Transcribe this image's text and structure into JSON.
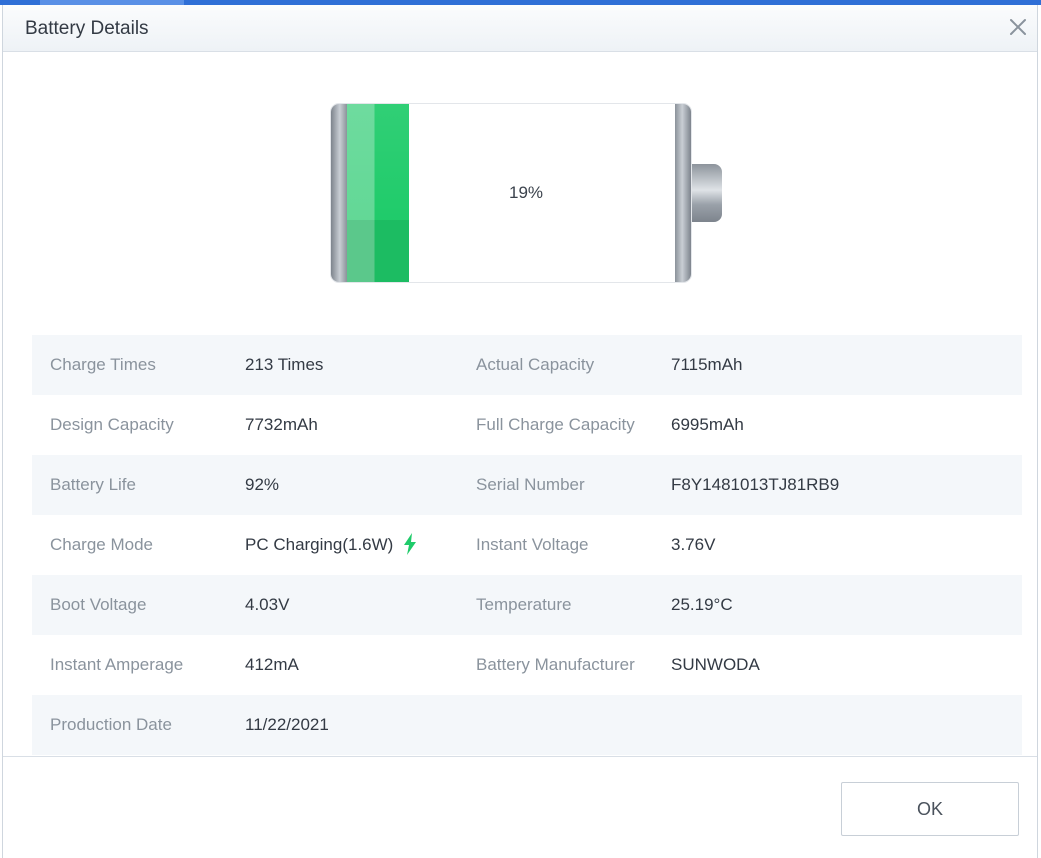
{
  "dialog": {
    "title": "Battery Details",
    "ok_label": "OK"
  },
  "battery": {
    "percent_text": "19%",
    "level": 0.19,
    "fill_color": "#1fcb6a"
  },
  "details": {
    "rows": [
      {
        "l1": "Charge Times",
        "v1": "213 Times",
        "l2": "Actual Capacity",
        "v2": "7115mAh"
      },
      {
        "l1": "Design Capacity",
        "v1": "7732mAh",
        "l2": "Full Charge Capacity",
        "v2": "6995mAh"
      },
      {
        "l1": "Battery Life",
        "v1": "92%",
        "l2": "Serial Number",
        "v2": "F8Y1481013TJ81RB9"
      },
      {
        "l1": "Charge Mode",
        "v1": "PC Charging(1.6W)",
        "l2": "Instant Voltage",
        "v2": "3.76V"
      },
      {
        "l1": "Boot Voltage",
        "v1": "4.03V",
        "l2": "Temperature",
        "v2": "25.19°C"
      },
      {
        "l1": "Instant Amperage",
        "v1": "412mA",
        "l2": "Battery Manufacturer",
        "v2": "SUNWODA"
      },
      {
        "l1": "Production Date",
        "v1": "11/22/2021",
        "l2": "",
        "v2": ""
      }
    ]
  },
  "icons": {
    "close": "close-icon",
    "charging": "lightning-bolt-icon"
  },
  "colors": {
    "accent": "#2f6fd6",
    "charging": "#1fcb6a",
    "row_alt": "#f4f7fa"
  }
}
